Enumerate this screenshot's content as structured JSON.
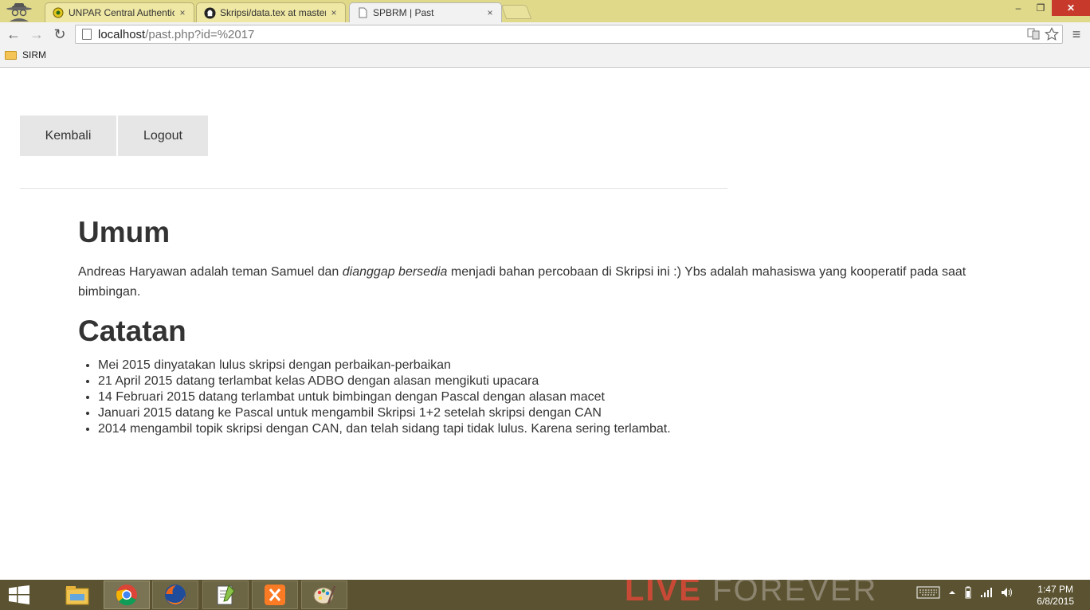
{
  "browser": {
    "tabs": [
      {
        "title": "UNPAR Central Authentic",
        "close": "×"
      },
      {
        "title": "Skripsi/data.tex at master",
        "close": "×"
      },
      {
        "title": "SPBRM | Past",
        "close": "×"
      }
    ],
    "window_buttons": {
      "minimize": "–",
      "maximize": "❐",
      "close": "✕"
    },
    "nav": {
      "back": "←",
      "forward": "→",
      "reload": "↻"
    },
    "url": {
      "host": "localhost",
      "path": "/past.php?id=%2017"
    },
    "menu": "≡",
    "bookmarks": [
      {
        "label": "SIRM"
      }
    ]
  },
  "page": {
    "nav_buttons": {
      "kembali": "Kembali",
      "logout": "Logout"
    },
    "umum": {
      "heading": "Umum",
      "text_before": "Andreas Haryawan adalah teman Samuel dan ",
      "text_italic": "dianggap bersedia",
      "text_after": " menjadi bahan percobaan di Skripsi ini :) Ybs adalah mahasiswa yang kooperatif pada saat bimbingan."
    },
    "catatan": {
      "heading": "Catatan",
      "items": [
        "Mei 2015 dinyatakan lulus skripsi dengan perbaikan-perbaikan",
        "21 April 2015 datang terlambat kelas ADBO dengan alasan mengikuti upacara",
        "14 Februari 2015 datang terlambat untuk bimbingan dengan Pascal dengan alasan macet",
        "Januari 2015 datang ke Pascal untuk mengambil Skripsi 1+2 setelah skripsi dengan CAN",
        "2014 mengambil topik skripsi dengan CAN, dan telah sidang tapi tidak lulus. Karena sering terlambat."
      ]
    }
  },
  "taskbar": {
    "wallpaper_text_bold": "LIVE",
    "wallpaper_text_light": " FOREVER",
    "clock": {
      "time": "1:47 PM",
      "date": "6/8/2015"
    }
  }
}
